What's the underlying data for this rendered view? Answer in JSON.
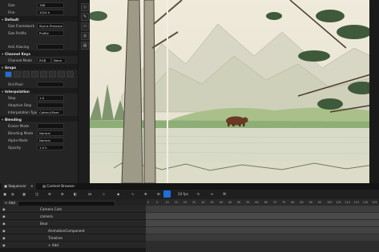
{
  "details": {
    "rows_top": [
      {
        "label": "Size",
        "value": "768"
      },
      {
        "label": "Fine",
        "value": "1024 h"
      }
    ],
    "sec_default": "Default",
    "rows_default": [
      {
        "label": "Size Framework",
        "value": "Stylus Pressure"
      },
      {
        "label": "Size Profile",
        "value": "Profile"
      },
      {
        "label": "Anti Aliasing",
        "value": ""
      }
    ],
    "sec_channel": "Channel Keys",
    "channel_mode_label": "Channel Mode",
    "channel_mode_value": "RGB",
    "channel_mode_value2": "None",
    "sec_grups": "Grups",
    "sec_brush": "",
    "rows_mid": [
      {
        "label": "Ord Pixel",
        "value": ""
      }
    ],
    "sec_interp": "Interpolation",
    "rows_interp": [
      {
        "label": "Step",
        "value": "1.0"
      },
      {
        "label": "Adaptive Step",
        "value": ""
      },
      {
        "label": "Interpolation Type",
        "value": "Catmull-Rom"
      }
    ],
    "sec_blending": "Blending",
    "rows_blend": [
      {
        "label": "Eraser Mode",
        "value": ""
      },
      {
        "label": "Blending Mode",
        "value": "Normal"
      },
      {
        "label": "Alpha Mode",
        "value": "Normal"
      },
      {
        "label": "Opacity",
        "value": "1.0 h"
      }
    ]
  },
  "sequencer": {
    "tab_label": "Sequencer",
    "tab2_label": "Content Browser",
    "add_label": "+ Add",
    "fps_label": "24 fps",
    "tracks": [
      {
        "label": "Camera Cuts"
      },
      {
        "label": "camera"
      },
      {
        "label": "Bear"
      },
      {
        "label": "AnimationComponent"
      },
      {
        "label": "Timeline"
      },
      {
        "label": "+ Add"
      }
    ],
    "ruler_labels": [
      "0",
      "5",
      "10",
      "15",
      "20",
      "25",
      "30",
      "35",
      "40",
      "45",
      "50",
      "55",
      "60",
      "65",
      "70",
      "75",
      "80",
      "85",
      "90",
      "95",
      "100",
      "105",
      "110",
      "115",
      "120",
      "125"
    ]
  },
  "colors": {
    "accent": "#1e6fd9",
    "panel": "#242424",
    "timeline_bar": "#474747"
  },
  "icons": [
    "settings-icon",
    "view-icon",
    "select-icon",
    "translate-icon",
    "brush-icon",
    "eraser-icon",
    "fill-icon",
    "layer-icon",
    "film-icon"
  ]
}
